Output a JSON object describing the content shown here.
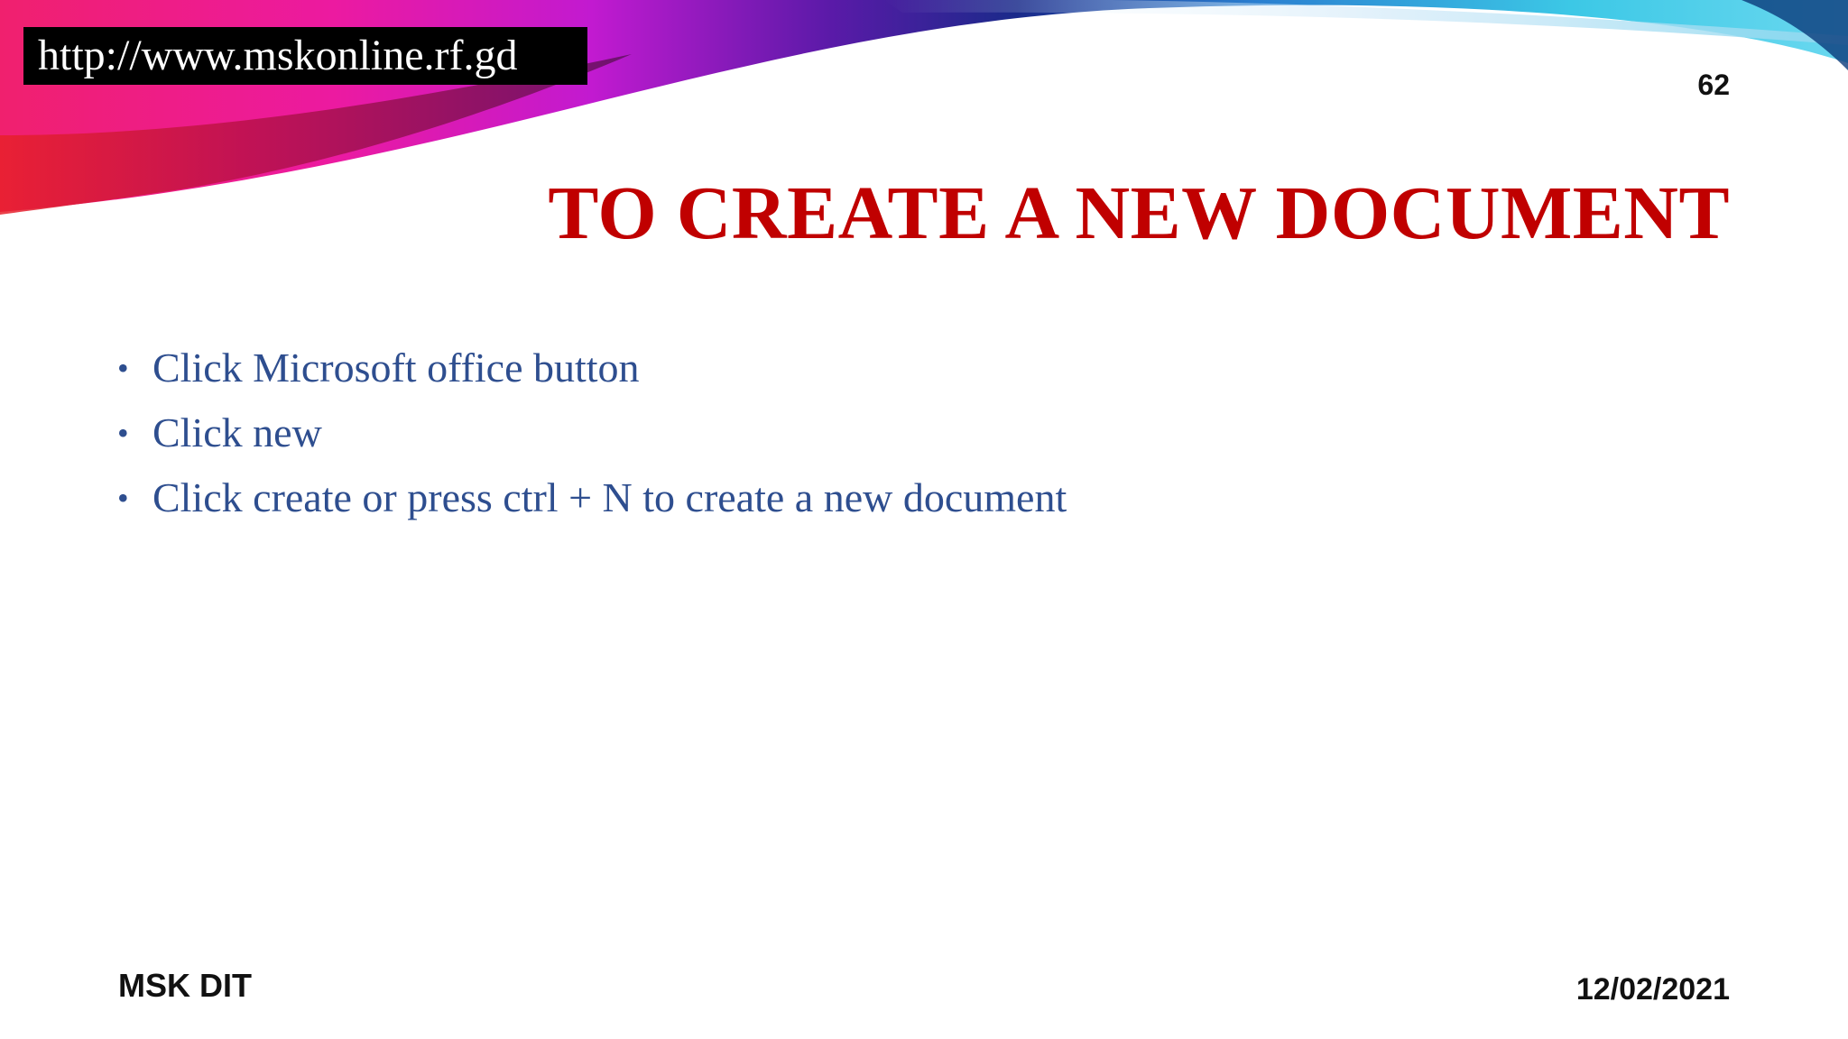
{
  "header": {
    "url": "http://www.mskonline.rf.gd",
    "slide_number": "62"
  },
  "title": "TO CREATE A NEW DOCUMENT",
  "bullets": [
    "Click Microsoft office button",
    "Click new",
    "Click create or press ctrl + N to create a new document"
  ],
  "footer": {
    "left": "MSK DIT",
    "right": "12/02/2021"
  },
  "colors": {
    "title": "#c00000",
    "bullet_text": "#2e4e8f",
    "swoosh_magenta": "#e0108c",
    "swoosh_purple": "#7a1fb8",
    "swoosh_cyan": "#3cc8e6"
  }
}
